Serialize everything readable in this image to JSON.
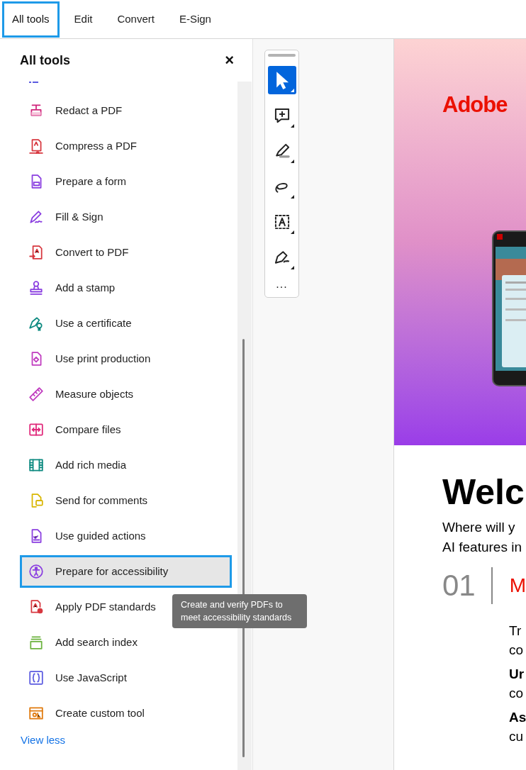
{
  "tabs": [
    {
      "label": "All tools",
      "selected": true
    },
    {
      "label": "Edit",
      "selected": false
    },
    {
      "label": "Convert",
      "selected": false
    },
    {
      "label": "E-Sign",
      "selected": false
    }
  ],
  "panel": {
    "title": "All tools",
    "close": "×",
    "view_less": "View less",
    "tools": [
      {
        "label": "Redact a PDF",
        "selected": false
      },
      {
        "label": "Compress a PDF",
        "selected": false
      },
      {
        "label": "Prepare a form",
        "selected": false
      },
      {
        "label": "Fill & Sign",
        "selected": false
      },
      {
        "label": "Convert to PDF",
        "selected": false
      },
      {
        "label": "Add a stamp",
        "selected": false
      },
      {
        "label": "Use a certificate",
        "selected": false
      },
      {
        "label": "Use print production",
        "selected": false
      },
      {
        "label": "Measure objects",
        "selected": false
      },
      {
        "label": "Compare files",
        "selected": false
      },
      {
        "label": "Add rich media",
        "selected": false
      },
      {
        "label": "Send for comments",
        "selected": false
      },
      {
        "label": "Use guided actions",
        "selected": false
      },
      {
        "label": "Prepare for accessibility",
        "selected": true
      },
      {
        "label": "Apply PDF standards",
        "selected": false
      },
      {
        "label": "Add search index",
        "selected": false
      },
      {
        "label": "Use JavaScript",
        "selected": false
      },
      {
        "label": "Create custom tool",
        "selected": false
      }
    ],
    "tooltip": "Create and verify PDFs to meet accessibility standards"
  },
  "toolbar": {
    "more": "...",
    "tools": [
      {
        "selected": true
      },
      {
        "selected": false
      },
      {
        "selected": false
      },
      {
        "selected": false
      },
      {
        "selected": false
      },
      {
        "selected": false
      }
    ]
  },
  "document": {
    "logo": "Adobe",
    "heading": "Welc",
    "intro": [
      "Where will y",
      "AI features in"
    ],
    "step_number": "01",
    "step_title": "M",
    "lines": [
      {
        "text": "Tr",
        "bold": false
      },
      {
        "text": "co",
        "bold": false
      },
      {
        "text": "Ur",
        "bold": true
      },
      {
        "text": "co",
        "bold": false
      },
      {
        "text": "As",
        "bold": true
      },
      {
        "text": "cu",
        "bold": false
      }
    ]
  }
}
